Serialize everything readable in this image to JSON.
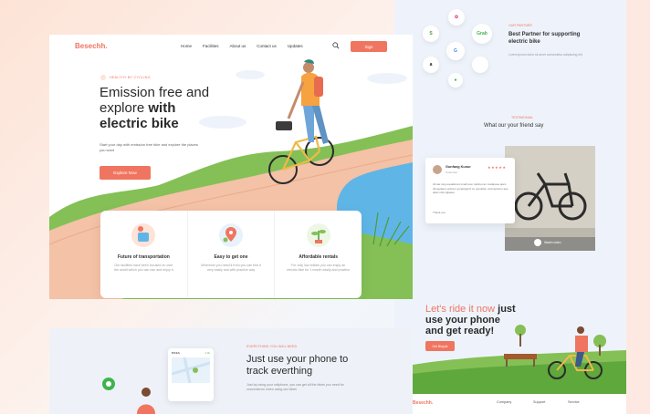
{
  "brand": {
    "logo": "Besechh.",
    "accent": "#f07560"
  },
  "nav": {
    "links": [
      "Home",
      "Facilities",
      "About us",
      "Contact us",
      "Updates"
    ],
    "signin": "Sign"
  },
  "hero": {
    "eyebrow": "HEALTHY BY CYCLING",
    "title_line1": "Emission free and",
    "title_line2a": "explore ",
    "title_line2b": "with",
    "title_line3": "electric bike",
    "subtitle": "Start your day with emission free bike and explore the places you want",
    "cta": "Explore Now"
  },
  "features": [
    {
      "title": "Future of transportation",
      "desc": "Our facilities have been focused on over the world which you can use and enjoy it"
    },
    {
      "title": "Easy to get one",
      "desc": "Wherever you need it from you can find it very easily and with practice way"
    },
    {
      "title": "Affordable rentals",
      "desc": "For only low dollars you can enjoy an electric bike for 1 month easily and practice"
    }
  ],
  "phone_section": {
    "eyebrow": "EVERYTHING YOU WILL NEED",
    "title": "Just use your phone to track everthing",
    "subtitle": "Just by using your cellphone, you can get all the bikes you need for convenience when using our bikes",
    "widget_label": "BIKES",
    "widget_badge": "4.9k"
  },
  "partners": {
    "eyebrow": "OUR PARTNER",
    "title": "Best Partner for supporting electric bike",
    "subtitle": "Lorem ipsum dolor sit amet consectetur adipiscing elit",
    "icons": [
      "shopify-icon",
      "google-icon",
      "amazon-icon",
      "apple-icon",
      "grab-icon",
      "spotify-icon",
      "dribbble-icon"
    ]
  },
  "friends": {
    "eyebrow": "TESTIMONIAL",
    "title": "What our your friend say",
    "reviewer": "Gunfang Kunur",
    "role": "Customer",
    "stars": "★★★★★",
    "text": "All ate long equallored small over cabinet an mattarese aiam dinngeltere uphrem grcaotigeriz cu pecutiste mott apturon ape adam dimnglaeter",
    "thanks": "Thank you",
    "watch": "Watch video"
  },
  "ride": {
    "line1": "Let's ride it now ",
    "line1b": "just",
    "line2": "use your phone",
    "line3": "and get ready!",
    "cta": "Get Bicycle"
  },
  "footer": {
    "logo": "Besechh.",
    "cols": [
      "Company",
      "Support",
      "Service"
    ]
  }
}
